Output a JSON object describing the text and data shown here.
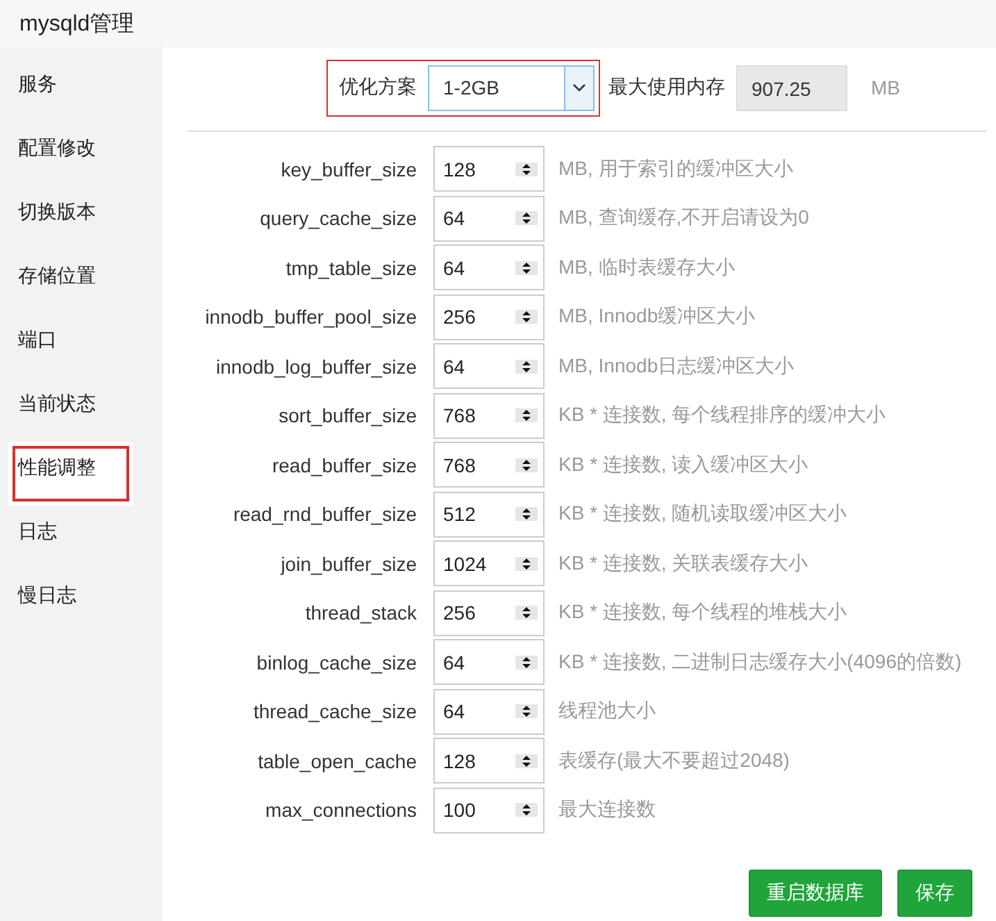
{
  "window": {
    "title": "mysqld管理"
  },
  "sidebar": {
    "items": [
      {
        "label": "服务",
        "selected": false
      },
      {
        "label": "配置修改",
        "selected": false
      },
      {
        "label": "切换版本",
        "selected": false
      },
      {
        "label": "存储位置",
        "selected": false
      },
      {
        "label": "端口",
        "selected": false
      },
      {
        "label": "当前状态",
        "selected": false
      },
      {
        "label": "性能调整",
        "selected": true
      },
      {
        "label": "日志",
        "selected": false
      },
      {
        "label": "慢日志",
        "selected": false
      }
    ]
  },
  "plan": {
    "label": "优化方案",
    "value": "1-2GB",
    "memory_label": "最大使用内存",
    "memory_value": "907.25",
    "memory_unit": "MB"
  },
  "settings": [
    {
      "name": "key_buffer_size",
      "value": "128",
      "hint": "MB, 用于索引的缓冲区大小"
    },
    {
      "name": "query_cache_size",
      "value": "64",
      "hint": "MB, 查询缓存,不开启请设为0"
    },
    {
      "name": "tmp_table_size",
      "value": "64",
      "hint": "MB, 临时表缓存大小"
    },
    {
      "name": "innodb_buffer_pool_size",
      "value": "256",
      "hint": "MB, Innodb缓冲区大小"
    },
    {
      "name": "innodb_log_buffer_size",
      "value": "64",
      "hint": "MB, Innodb日志缓冲区大小"
    },
    {
      "name": "sort_buffer_size",
      "value": "768",
      "hint": "KB * 连接数, 每个线程排序的缓冲大小"
    },
    {
      "name": "read_buffer_size",
      "value": "768",
      "hint": "KB * 连接数, 读入缓冲区大小"
    },
    {
      "name": "read_rnd_buffer_size",
      "value": "512",
      "hint": "KB * 连接数, 随机读取缓冲区大小"
    },
    {
      "name": "join_buffer_size",
      "value": "1024",
      "hint": "KB * 连接数, 关联表缓存大小"
    },
    {
      "name": "thread_stack",
      "value": "256",
      "hint": "KB * 连接数, 每个线程的堆栈大小"
    },
    {
      "name": "binlog_cache_size",
      "value": "64",
      "hint": "KB * 连接数, 二进制日志缓存大小(4096的倍数)"
    },
    {
      "name": "thread_cache_size",
      "value": "64",
      "hint": "线程池大小"
    },
    {
      "name": "table_open_cache",
      "value": "128",
      "hint": "表缓存(最大不要超过2048)"
    },
    {
      "name": "max_connections",
      "value": "100",
      "hint": "最大连接数"
    }
  ],
  "buttons": [
    "重启数据库",
    "保存"
  ]
}
